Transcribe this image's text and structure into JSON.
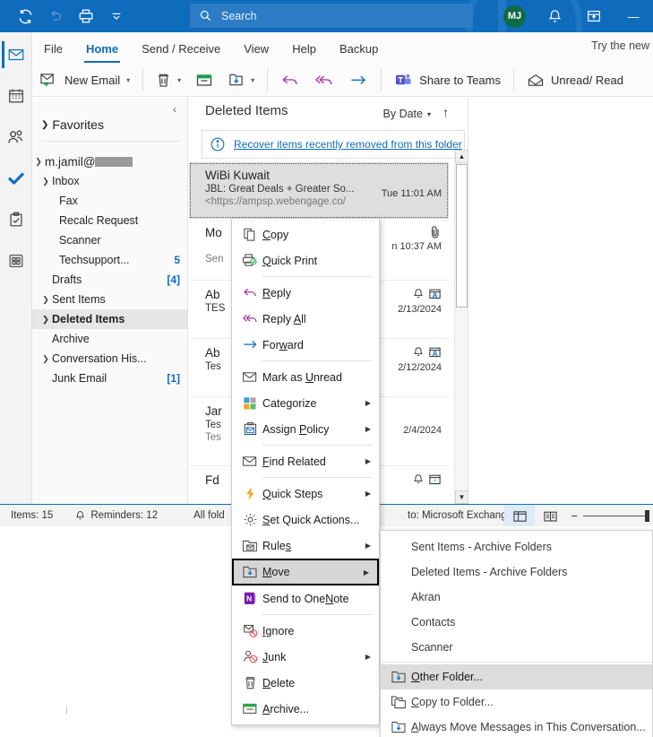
{
  "titlebar": {
    "quick_access": [
      {
        "name": "sync-icon",
        "label": "Send/Receive All Folders"
      },
      {
        "name": "undo-icon",
        "label": "Undo"
      },
      {
        "name": "print-icon",
        "label": "Print"
      },
      {
        "name": "chevron-down-icon",
        "label": "Customize Quick Access Toolbar"
      }
    ],
    "search": {
      "placeholder": "Search",
      "value": "",
      "icon": "search-icon"
    },
    "account_initials": "MJ",
    "notifications_icon": "bell-icon",
    "upgrade_icon": "coming-soon-icon",
    "minimize_label": "—"
  },
  "rail": {
    "items": [
      {
        "name": "mail",
        "icon": "mail-icon",
        "active": true
      },
      {
        "name": "calendar",
        "icon": "calendar-icon",
        "active": false
      },
      {
        "name": "people",
        "icon": "people-icon",
        "active": false
      },
      {
        "name": "todo",
        "icon": "checkmark-icon",
        "active": false
      },
      {
        "name": "tasks",
        "icon": "clipboard-icon",
        "active": false
      },
      {
        "name": "more-apps",
        "icon": "grid-icon",
        "active": false
      }
    ]
  },
  "ribbon": {
    "tabs": [
      {
        "label": "File",
        "active": false
      },
      {
        "label": "Home",
        "active": true
      },
      {
        "label": "Send / Receive",
        "active": false
      },
      {
        "label": "View",
        "active": false
      },
      {
        "label": "Help",
        "active": false
      },
      {
        "label": "Backup",
        "active": false
      }
    ],
    "try_new": "Try the new",
    "commands": {
      "new_email": "New Email",
      "delete_icon": "trash-icon",
      "archive_icon": "archive-icon",
      "move_icon": "move-icon",
      "reply_icon": "reply-icon",
      "reply_all_icon": "reply-all-icon",
      "forward_icon": "forward-icon",
      "share_to_teams": "Share to Teams",
      "unread_read": "Unread/ Read"
    }
  },
  "folder_pane": {
    "favorites": "Favorites",
    "account": "m.jamil@",
    "account_redacted": true,
    "items": [
      {
        "label": "Inbox",
        "caret": "expanded",
        "indent": 1,
        "count": "",
        "selected": false
      },
      {
        "label": "Fax",
        "caret": "none",
        "indent": 2,
        "count": "",
        "selected": false
      },
      {
        "label": "Recalc Request",
        "caret": "none",
        "indent": 2,
        "count": "",
        "selected": false
      },
      {
        "label": "Scanner",
        "caret": "none",
        "indent": 2,
        "count": "",
        "selected": false
      },
      {
        "label": "Techsupport...",
        "caret": "none",
        "indent": 2,
        "count": "5",
        "selected": false
      },
      {
        "label": "Drafts",
        "caret": "none",
        "indent": 1,
        "count": "[4]",
        "selected": false
      },
      {
        "label": "Sent Items",
        "caret": "collapsed",
        "indent": 1,
        "count": "",
        "selected": false
      },
      {
        "label": "Deleted Items",
        "caret": "collapsed",
        "indent": 1,
        "count": "",
        "selected": true
      },
      {
        "label": "Archive",
        "caret": "none",
        "indent": 1,
        "count": "",
        "selected": false
      },
      {
        "label": "Conversation His...",
        "caret": "collapsed",
        "indent": 1,
        "count": "",
        "selected": false
      },
      {
        "label": "Junk Email",
        "caret": "none",
        "indent": 1,
        "count": "[1]",
        "selected": false
      }
    ]
  },
  "message_list": {
    "title": "Deleted Items",
    "sort_label": "By Date",
    "sort_direction_icon": "arrow-up-icon",
    "recover_banner": {
      "icon": "info-icon",
      "link": "Recover items recently removed from this folder"
    },
    "messages": [
      {
        "from": "WiBi Kuwait",
        "subject": "JBL: Great Deals + Greater So...",
        "preview": "<https://ampsp.webengage.co/",
        "time": "Tue 11:01 AM",
        "selected": true,
        "icons": []
      },
      {
        "from": "Mo",
        "subject": "",
        "preview": "Sen",
        "time": "n 10:37 AM",
        "selected": false,
        "icons": [
          "attachment-icon"
        ]
      },
      {
        "from": "Ab",
        "subject": "TES",
        "preview": "",
        "time": "2/13/2024",
        "selected": false,
        "icons": [
          "reminder-icon",
          "meeting-icon"
        ]
      },
      {
        "from": "Ab",
        "subject": "Tes",
        "preview": "",
        "time": "2/12/2024",
        "selected": false,
        "icons": [
          "reminder-icon",
          "meeting-icon"
        ]
      },
      {
        "from": "Jar",
        "subject": "Tes",
        "preview": "Tes",
        "time": "2/4/2024",
        "selected": false,
        "icons": []
      },
      {
        "from": "Fd",
        "subject": "",
        "preview": "",
        "time": "",
        "selected": false,
        "icons": [
          "reminder-icon",
          "meeting-icon"
        ]
      }
    ]
  },
  "status_bar": {
    "items_count": "Items: 15",
    "reminders": "Reminders: 12",
    "all_folders": "All fold",
    "connection": "to: Microsoft Exchange",
    "view_normal_icon": "normal-view-icon",
    "view_reading_icon": "reading-view-icon",
    "zoom_minus": "−"
  },
  "context_menu": {
    "items": [
      {
        "label": "Copy",
        "accel": "C",
        "icon": "copy-icon",
        "submenu": false,
        "highlighted": false,
        "separator_after": false
      },
      {
        "label": "Quick Print",
        "accel": "Q",
        "icon": "quick-print-icon",
        "submenu": false,
        "highlighted": false,
        "separator_after": true
      },
      {
        "label": "Reply",
        "accel": "R",
        "icon": "reply-icon",
        "submenu": false,
        "highlighted": false,
        "separator_after": false
      },
      {
        "label": "Reply All",
        "accel": "A",
        "icon": "reply-all-icon",
        "submenu": false,
        "highlighted": false,
        "separator_after": false
      },
      {
        "label": "Forward",
        "accel": "w",
        "icon": "forward-icon",
        "submenu": false,
        "highlighted": false,
        "separator_after": true
      },
      {
        "label": "Mark as Unread",
        "accel": "U",
        "icon": "envelope-icon",
        "submenu": false,
        "highlighted": false,
        "separator_after": false
      },
      {
        "label": "Categorize",
        "accel": "g",
        "icon": "categorize-icon",
        "submenu": true,
        "highlighted": false,
        "separator_after": false
      },
      {
        "label": "Assign Policy",
        "accel": "P",
        "icon": "policy-icon",
        "submenu": true,
        "highlighted": false,
        "separator_after": true
      },
      {
        "label": "Find Related",
        "accel": "F",
        "icon": "find-related-icon",
        "submenu": true,
        "highlighted": false,
        "separator_after": true
      },
      {
        "label": "Quick Steps",
        "accel": "Q",
        "icon": "lightning-icon",
        "submenu": true,
        "highlighted": false,
        "separator_after": false
      },
      {
        "label": "Set Quick Actions...",
        "accel": "S",
        "icon": "gear-icon",
        "submenu": false,
        "highlighted": false,
        "separator_after": false
      },
      {
        "label": "Rules",
        "accel": "s",
        "icon": "rules-icon",
        "submenu": true,
        "highlighted": false,
        "separator_after": false
      },
      {
        "label": "Move",
        "accel": "M",
        "icon": "move-icon",
        "submenu": true,
        "highlighted": true,
        "separator_after": false
      },
      {
        "label": "Send to OneNote",
        "accel": "N",
        "icon": "onenote-icon",
        "submenu": false,
        "highlighted": false,
        "separator_after": true
      },
      {
        "label": "Ignore",
        "accel": "I",
        "icon": "ignore-icon",
        "submenu": false,
        "highlighted": false,
        "separator_after": false
      },
      {
        "label": "Junk",
        "accel": "J",
        "icon": "junk-icon",
        "submenu": true,
        "highlighted": false,
        "separator_after": false
      },
      {
        "label": "Delete",
        "accel": "D",
        "icon": "trash-icon",
        "submenu": false,
        "highlighted": false,
        "separator_after": false
      },
      {
        "label": "Archive...",
        "accel": "A",
        "icon": "archive-icon",
        "submenu": false,
        "highlighted": false,
        "separator_after": false
      }
    ]
  },
  "move_submenu": {
    "items": [
      {
        "label": "Sent Items - Archive Folders",
        "accel": "",
        "icon": "",
        "highlighted": false,
        "separator_after": false
      },
      {
        "label": "Deleted Items - Archive Folders",
        "accel": "",
        "icon": "",
        "highlighted": false,
        "separator_after": false
      },
      {
        "label": "Akran",
        "accel": "",
        "icon": "",
        "highlighted": false,
        "separator_after": false
      },
      {
        "label": "Contacts",
        "accel": "",
        "icon": "",
        "highlighted": false,
        "separator_after": false
      },
      {
        "label": "Scanner",
        "accel": "",
        "icon": "",
        "highlighted": false,
        "separator_after": true
      },
      {
        "label": "Other Folder...",
        "accel": "O",
        "icon": "move-icon",
        "highlighted": true,
        "separator_after": false
      },
      {
        "label": "Copy to Folder...",
        "accel": "C",
        "icon": "copy-folder-icon",
        "highlighted": false,
        "separator_after": false
      },
      {
        "label": "Always Move Messages in This Conversation...",
        "accel": "A",
        "icon": "move-icon",
        "highlighted": false,
        "separator_after": false
      }
    ]
  },
  "colors": {
    "accent": "#0f6cbd",
    "titlebar": "#0f6cbd",
    "selection": "#dedede",
    "link": "#0f6cbd"
  }
}
